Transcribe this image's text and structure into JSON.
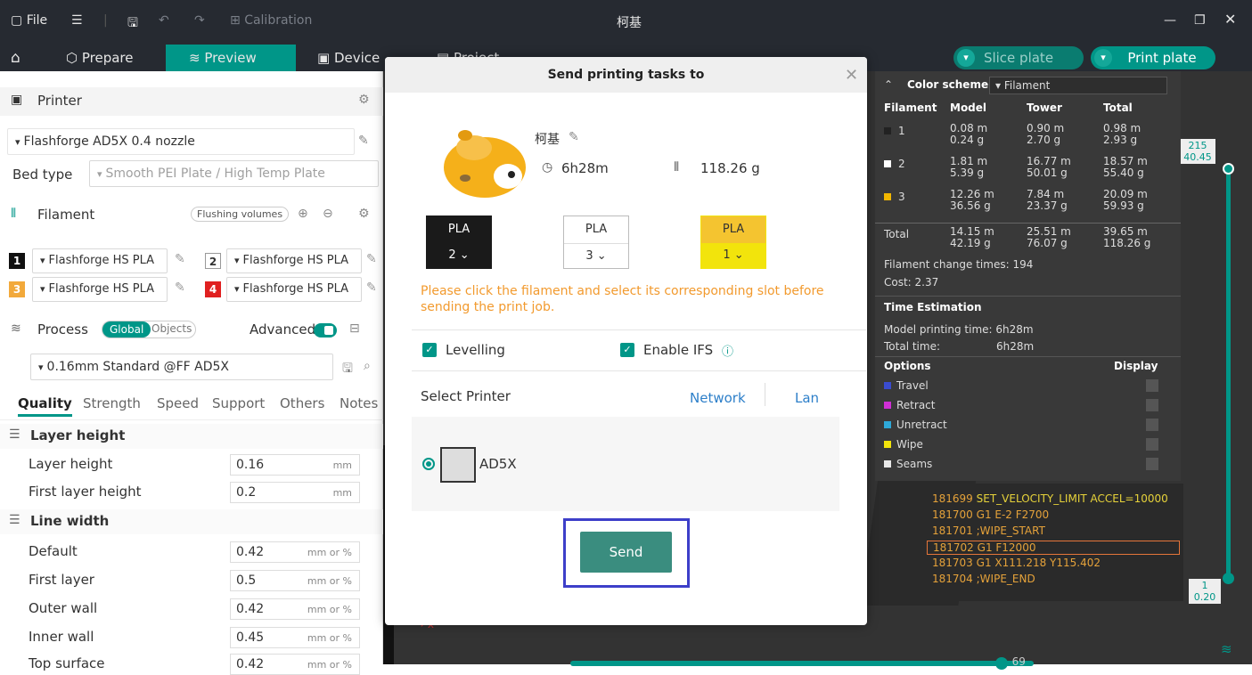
{
  "titlebar": {
    "file": "File",
    "calibration": "Calibration",
    "title": "柯基"
  },
  "nav": {
    "home": "",
    "prepare": "Prepare",
    "preview": "Preview",
    "device": "Device",
    "project": "Project",
    "slice": "Slice plate",
    "print": "Print plate"
  },
  "left": {
    "printer_title": "Printer",
    "printer_name": "Flashforge AD5X 0.4 nozzle",
    "bed_label": "Bed type",
    "bed_value": "Smooth PEI Plate / High Temp Plate",
    "filament_title": "Filament",
    "flushing": "Flushing volumes",
    "filaments": [
      {
        "num": "1",
        "name": "Flashforge HS PLA"
      },
      {
        "num": "2",
        "name": "Flashforge HS PLA"
      },
      {
        "num": "3",
        "name": "Flashforge HS PLA"
      },
      {
        "num": "4",
        "name": "Flashforge HS PLA"
      }
    ],
    "process_title": "Process",
    "global": "Global",
    "objects": "Objects",
    "advanced": "Advanced",
    "profile": "0.16mm Standard @FF AD5X",
    "tabs": [
      "Quality",
      "Strength",
      "Speed",
      "Support",
      "Others",
      "Notes"
    ],
    "groups": {
      "layer": "Layer height",
      "line": "Line width"
    },
    "params": [
      {
        "label": "Layer height",
        "value": "0.16",
        "unit": "mm"
      },
      {
        "label": "First layer height",
        "value": "0.2",
        "unit": "mm"
      },
      {
        "label": "Default",
        "value": "0.42",
        "unit": "mm or %"
      },
      {
        "label": "First layer",
        "value": "0.5",
        "unit": "mm or %"
      },
      {
        "label": "Outer wall",
        "value": "0.42",
        "unit": "mm or %"
      },
      {
        "label": "Inner wall",
        "value": "0.45",
        "unit": "mm or %"
      },
      {
        "label": "Top surface",
        "value": "0.42",
        "unit": "mm or %"
      }
    ]
  },
  "dialog": {
    "title": "Send printing tasks to",
    "model_name": "柯基",
    "time": "6h28m",
    "weight": "118.26 g",
    "slots": [
      {
        "type": "PLA",
        "slot": "2",
        "bg": "#1a1a1a",
        "fg": "#ffffff"
      },
      {
        "type": "PLA",
        "slot": "3",
        "bg": "#ffffff",
        "fg": "#333333"
      },
      {
        "type": "PLA",
        "slot": "1",
        "bg": "#f2e40c",
        "fg": "#333333"
      }
    ],
    "warning": "Please click the filament and select its corresponding slot before sending the print job.",
    "levelling": "Levelling",
    "ifs": "Enable IFS",
    "select_printer": "Select Printer",
    "network": "Network",
    "lan": "Lan",
    "printer": "AD5X",
    "send": "Send"
  },
  "stats": {
    "color_scheme": "Color scheme",
    "scheme_value": "Filament",
    "headers": [
      "Filament",
      "Model",
      "Tower",
      "Total"
    ],
    "rows": [
      {
        "id": "1",
        "color": "#222222",
        "model": [
          "0.08 m",
          "0.24 g"
        ],
        "tower": [
          "0.90 m",
          "2.70 g"
        ],
        "total": [
          "0.98 m",
          "2.93 g"
        ]
      },
      {
        "id": "2",
        "color": "#ffffff",
        "model": [
          "1.81 m",
          "5.39 g"
        ],
        "tower": [
          "16.77 m",
          "50.01 g"
        ],
        "total": [
          "18.57 m",
          "55.40 g"
        ]
      },
      {
        "id": "3",
        "color": "#f2b700",
        "model": [
          "12.26 m",
          "36.56 g"
        ],
        "tower": [
          "7.84 m",
          "23.37 g"
        ],
        "total": [
          "20.09 m",
          "59.93 g"
        ]
      }
    ],
    "total_label": "Total",
    "total_model": [
      "14.15 m",
      "42.19 g"
    ],
    "total_tower": [
      "25.51 m",
      "76.07 g"
    ],
    "total_total": [
      "39.65 m",
      "118.26 g"
    ],
    "change_times": "Filament change times:  194",
    "cost": "Cost:  2.37",
    "time_est": "Time Estimation",
    "model_time": "Model printing time:  6h28m",
    "total_time_label": "Total time:",
    "total_time": "6h28m",
    "options": "Options",
    "display": "Display",
    "opts": [
      {
        "name": "Travel",
        "color": "#3a4ccf"
      },
      {
        "name": "Retract",
        "color": "#d12fd6"
      },
      {
        "name": "Unretract",
        "color": "#2ea8d8"
      },
      {
        "name": "Wipe",
        "color": "#f2e40c"
      },
      {
        "name": "Seams",
        "color": "#e8e8e8"
      }
    ]
  },
  "gcode": [
    {
      "n": "181699",
      "t": "SET_VELOCITY_LIMIT ACCEL=10000"
    },
    {
      "n": "181700",
      "t": "G1 E-2 F2700"
    },
    {
      "n": "181701",
      "t": ";WIPE_START"
    },
    {
      "n": "181702",
      "t": "G1 F12000"
    },
    {
      "n": "181703",
      "t": "G1 X111.218 Y115.402"
    },
    {
      "n": "181704",
      "t": ";WIPE_END"
    }
  ],
  "slider": {
    "top": "215",
    "top_sub": "40.45",
    "bottom": "1",
    "bottom_sub": "0.20",
    "h": "69",
    "h_fraction": 0.93
  }
}
